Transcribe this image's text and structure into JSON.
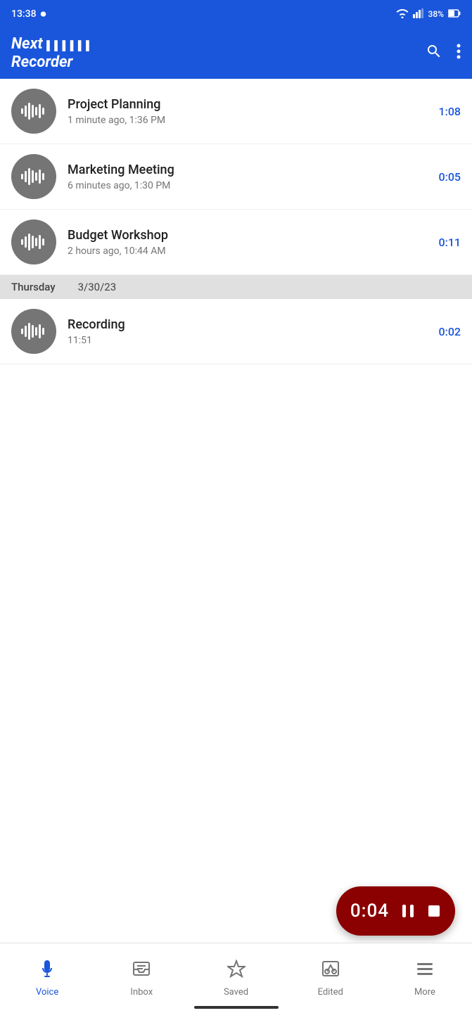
{
  "statusBar": {
    "time": "13:38",
    "battery": "38%",
    "batteryIcon": "🔋"
  },
  "header": {
    "title_line1": "Next",
    "title_bars": "▌▌▌▌▌▌",
    "title_line2": "Recorder",
    "searchLabel": "search",
    "menuLabel": "more-options"
  },
  "recordings": [
    {
      "id": 1,
      "title": "Project Planning",
      "meta": "1 minute ago, 1:36 PM",
      "duration": "1:08"
    },
    {
      "id": 2,
      "title": "Marketing Meeting",
      "meta": "6 minutes ago, 1:30 PM",
      "duration": "0:05"
    },
    {
      "id": 3,
      "title": "Budget Workshop",
      "meta": "2 hours ago, 10:44 AM",
      "duration": "0:11"
    }
  ],
  "dateSeparator": {
    "day": "Thursday",
    "date": "3/30/23"
  },
  "recordingsOld": [
    {
      "id": 4,
      "title": "Recording",
      "meta": "11:51",
      "duration": "0:02"
    }
  ],
  "player": {
    "time": "0:04",
    "pauseLabel": "pause",
    "stopLabel": "stop"
  },
  "bottomNav": [
    {
      "id": "voice",
      "label": "Voice",
      "icon": "🎤",
      "active": true
    },
    {
      "id": "inbox",
      "label": "Inbox",
      "icon": "📋",
      "active": false
    },
    {
      "id": "saved",
      "label": "Saved",
      "icon": "⭐",
      "active": false
    },
    {
      "id": "edited",
      "label": "Edited",
      "icon": "✂",
      "active": false
    },
    {
      "id": "more",
      "label": "More",
      "icon": "☰",
      "active": false
    }
  ]
}
